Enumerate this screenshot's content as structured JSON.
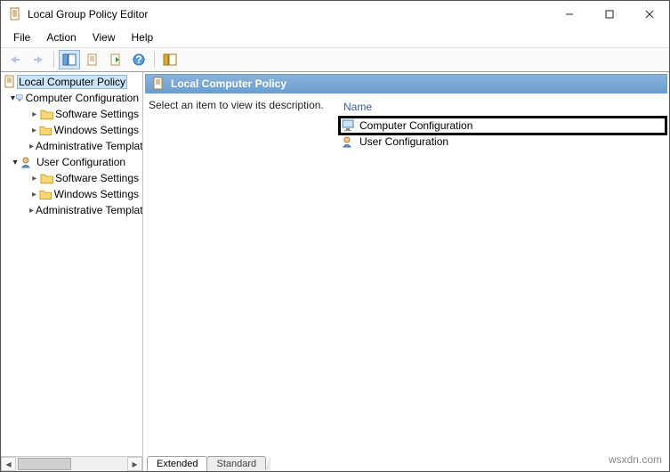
{
  "window": {
    "title": "Local Group Policy Editor"
  },
  "menu": {
    "file": "File",
    "action": "Action",
    "view": "View",
    "help": "Help"
  },
  "tree": {
    "root": "Local Computer Policy",
    "cc": "Computer Configuration",
    "cc_sw": "Software Settings",
    "cc_ws": "Windows Settings",
    "cc_at": "Administrative Templates",
    "uc": "User Configuration",
    "uc_sw": "Software Settings",
    "uc_ws": "Windows Settings",
    "uc_at": "Administrative Templates"
  },
  "detail": {
    "header": "Local Computer Policy",
    "description": "Select an item to view its description.",
    "name_col": "Name",
    "item1": "Computer Configuration",
    "item2": "User Configuration"
  },
  "tabs": {
    "extended": "Extended",
    "standard": "Standard"
  },
  "watermark": "wsxdn.com"
}
